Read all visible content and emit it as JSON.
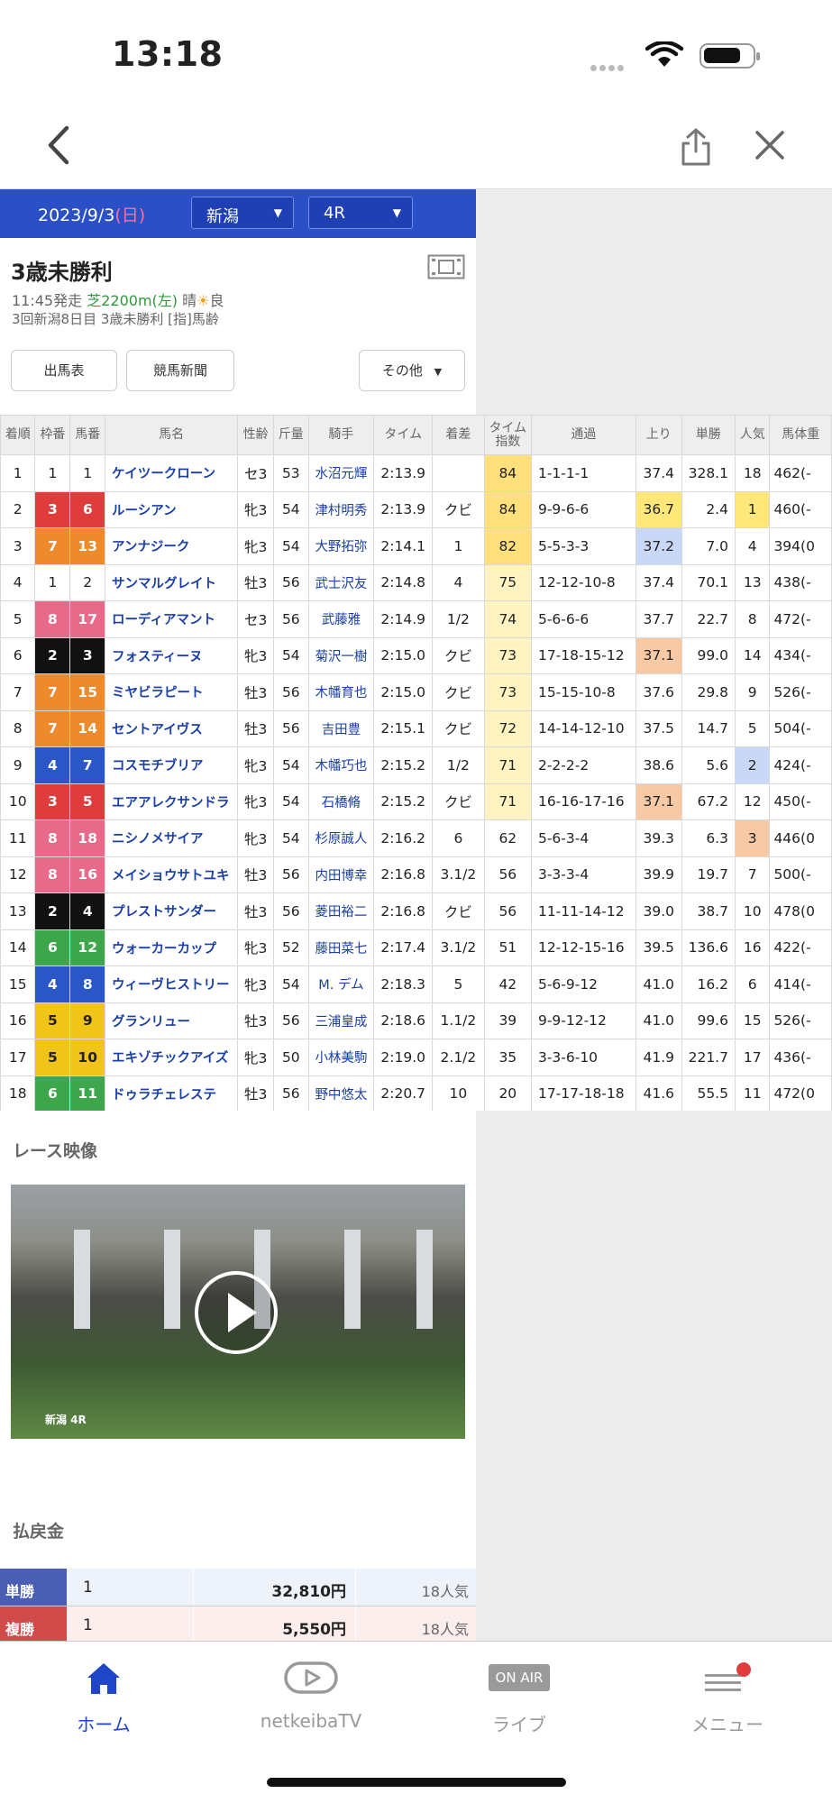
{
  "status_bar": {
    "time": "13:18"
  },
  "race": {
    "date": "2023/9/3",
    "day": "(日)",
    "venue": "新潟",
    "race_no": "4R",
    "title": "3歳未勝利",
    "start": "11:45発走",
    "course": "芝2200m(左)",
    "weather": "晴",
    "condition": "良",
    "meeting": "3回新潟8日目 3歳未勝利 [指]馬齢"
  },
  "buttons": {
    "shutuba": "出馬表",
    "shinbun": "競馬新聞",
    "other": "その他"
  },
  "table": {
    "headers": [
      "着順",
      "枠番",
      "馬番",
      "馬名",
      "性齢",
      "斤量",
      "騎手",
      "タイム",
      "着差",
      "タイム指数",
      "通過",
      "上り",
      "単勝",
      "人気",
      "馬体重"
    ],
    "rows": [
      [
        "1",
        "1",
        "1",
        "ケイツークローン",
        "セ3",
        "53",
        "水沼元輝",
        "2:13.9",
        "",
        "84",
        "1-1-1-1",
        "37.4",
        "328.1",
        "18",
        "462(-"
      ],
      [
        "2",
        "3",
        "6",
        "ルーシアン",
        "牝3",
        "54",
        "津村明秀",
        "2:13.9",
        "クビ",
        "84",
        "9-9-6-6",
        "36.7",
        "2.4",
        "1",
        "460(-"
      ],
      [
        "3",
        "7",
        "13",
        "アンナジーク",
        "牝3",
        "54",
        "大野拓弥",
        "2:14.1",
        "1",
        "82",
        "5-5-3-3",
        "37.2",
        "7.0",
        "4",
        "394(0"
      ],
      [
        "4",
        "1",
        "2",
        "サンマルグレイト",
        "牡3",
        "56",
        "武士沢友",
        "2:14.8",
        "4",
        "75",
        "12-12-10-8",
        "37.4",
        "70.1",
        "13",
        "438(-"
      ],
      [
        "5",
        "8",
        "17",
        "ローディアマント",
        "セ3",
        "56",
        "武藤雅",
        "2:14.9",
        "1/2",
        "74",
        "5-6-6-6",
        "37.7",
        "22.7",
        "8",
        "472(-"
      ],
      [
        "6",
        "2",
        "3",
        "フォスティーヌ",
        "牝3",
        "54",
        "菊沢一樹",
        "2:15.0",
        "クビ",
        "73",
        "17-18-15-12",
        "37.1",
        "99.0",
        "14",
        "434(-"
      ],
      [
        "7",
        "7",
        "15",
        "ミヤビラピート",
        "牡3",
        "56",
        "木幡育也",
        "2:15.0",
        "クビ",
        "73",
        "15-15-10-8",
        "37.6",
        "29.8",
        "9",
        "526(-"
      ],
      [
        "8",
        "7",
        "14",
        "セントアイヴス",
        "牡3",
        "56",
        "吉田豊",
        "2:15.1",
        "クビ",
        "72",
        "14-14-12-10",
        "37.5",
        "14.7",
        "5",
        "504(-"
      ],
      [
        "9",
        "4",
        "7",
        "コスモチブリア",
        "牝3",
        "54",
        "木幡巧也",
        "2:15.2",
        "1/2",
        "71",
        "2-2-2-2",
        "38.6",
        "5.6",
        "2",
        "424(-"
      ],
      [
        "10",
        "3",
        "5",
        "エアアレクサンドラ",
        "牝3",
        "54",
        "石橋脩",
        "2:15.2",
        "クビ",
        "71",
        "16-16-17-16",
        "37.1",
        "67.2",
        "12",
        "450(-"
      ],
      [
        "11",
        "8",
        "18",
        "ニシノメサイア",
        "牝3",
        "54",
        "杉原誠人",
        "2:16.2",
        "6",
        "62",
        "5-6-3-4",
        "39.3",
        "6.3",
        "3",
        "446(0"
      ],
      [
        "12",
        "8",
        "16",
        "メイショウサトユキ",
        "牡3",
        "56",
        "内田博幸",
        "2:16.8",
        "3.1/2",
        "56",
        "3-3-3-4",
        "39.9",
        "19.7",
        "7",
        "500(-"
      ],
      [
        "13",
        "2",
        "4",
        "プレストサンダー",
        "牡3",
        "56",
        "菱田裕二",
        "2:16.8",
        "クビ",
        "56",
        "11-11-14-12",
        "39.0",
        "38.7",
        "10",
        "478(0"
      ],
      [
        "14",
        "6",
        "12",
        "ウォーカーカップ",
        "牝3",
        "52",
        "藤田菜七",
        "2:17.4",
        "3.1/2",
        "51",
        "12-12-15-16",
        "39.5",
        "136.6",
        "16",
        "422(-"
      ],
      [
        "15",
        "4",
        "8",
        "ウィーヴヒストリー",
        "牝3",
        "54",
        "M. デム",
        "2:18.3",
        "5",
        "42",
        "5-6-9-12",
        "41.0",
        "16.2",
        "6",
        "414(-"
      ],
      [
        "16",
        "5",
        "9",
        "グランリュー",
        "牡3",
        "56",
        "三浦皇成",
        "2:18.6",
        "1.1/2",
        "39",
        "9-9-12-12",
        "41.0",
        "99.6",
        "15",
        "526(-"
      ],
      [
        "17",
        "5",
        "10",
        "エキゾチックアイズ",
        "牝3",
        "50",
        "小林美駒",
        "2:19.0",
        "2.1/2",
        "35",
        "3-3-6-10",
        "41.9",
        "221.7",
        "17",
        "436(-"
      ],
      [
        "18",
        "6",
        "11",
        "ドゥラチェレステ",
        "牡3",
        "56",
        "野中悠太",
        "2:20.7",
        "10",
        "20",
        "17-17-18-18",
        "41.6",
        "55.5",
        "11",
        "472(0"
      ]
    ]
  },
  "video": {
    "title": "レース映像",
    "overlay": "新潟 4R"
  },
  "payout": {
    "title": "払戻金",
    "rows": [
      {
        "type": "単勝",
        "num": "1",
        "amount": "32,810円",
        "pop": "18人気"
      },
      {
        "type": "複勝",
        "num": "1",
        "amount": "5,550円",
        "pop": "18人気"
      }
    ]
  },
  "tabbar": {
    "home": "ホーム",
    "tv": "netkeibaTV",
    "live": "ライブ",
    "live_badge": "ON AIR",
    "menu": "メニュー"
  },
  "colors": {
    "accent": "#2a4fc6",
    "waku": {
      "1": "#ffffff",
      "2": "#111111",
      "3": "#e03c3c",
      "4": "#2b57c6",
      "5": "#f0c419",
      "6": "#3ea74c",
      "7": "#ec8a2c",
      "8": "#e86a8a"
    }
  }
}
